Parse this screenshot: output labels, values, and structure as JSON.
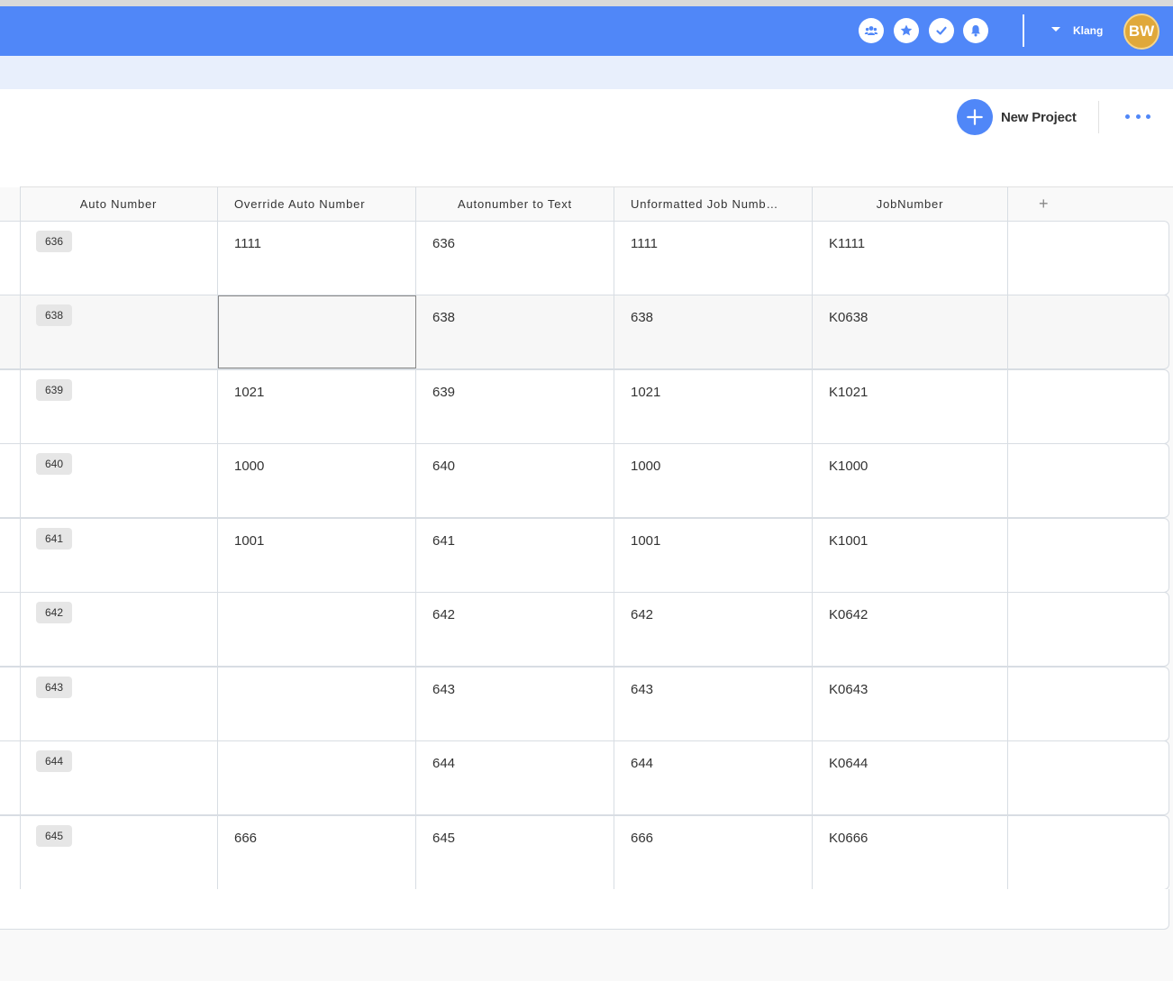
{
  "topbar": {
    "icons": [
      "team-icon",
      "star-icon",
      "check-icon",
      "bell-icon"
    ],
    "workspace": "Klang",
    "avatar_initials": "BW",
    "colors": {
      "bar": "#5087f8",
      "avatar": "#e0a83a"
    }
  },
  "header": {
    "new_project_label": "New Project"
  },
  "table": {
    "columns": [
      "Auto Number",
      "Override Auto Number",
      "Autonumber to Text",
      "Unformatted Job Numb…",
      "JobNumber"
    ],
    "add_column_label": "+",
    "rows": [
      {
        "auto": "636",
        "override": "1111",
        "text": "636",
        "unformatted": "1111",
        "job": "K1111"
      },
      {
        "auto": "638",
        "override": "",
        "text": "638",
        "unformatted": "638",
        "job": "K0638"
      },
      {
        "auto": "639",
        "override": "1021",
        "text": "639",
        "unformatted": "1021",
        "job": "K1021"
      },
      {
        "auto": "640",
        "override": "1000",
        "text": "640",
        "unformatted": "1000",
        "job": "K1000"
      },
      {
        "auto": "641",
        "override": "1001",
        "text": "641",
        "unformatted": "1001",
        "job": "K1001"
      },
      {
        "auto": "642",
        "override": "",
        "text": "642",
        "unformatted": "642",
        "job": "K0642"
      },
      {
        "auto": "643",
        "override": "",
        "text": "643",
        "unformatted": "643",
        "job": "K0643"
      },
      {
        "auto": "644",
        "override": "",
        "text": "644",
        "unformatted": "644",
        "job": "K0644"
      },
      {
        "auto": "645",
        "override": "666",
        "text": "645",
        "unformatted": "666",
        "job": "K0666"
      }
    ]
  }
}
